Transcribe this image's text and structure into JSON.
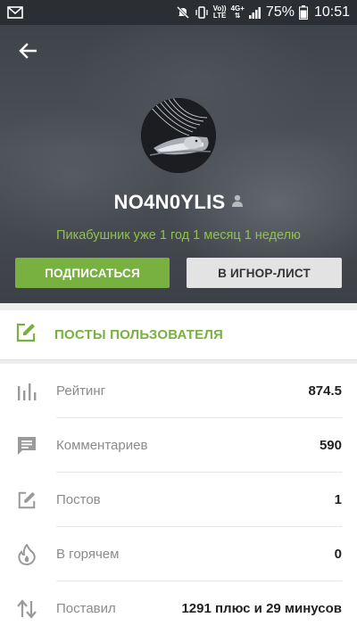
{
  "status_bar": {
    "battery": "75%",
    "time": "10:51",
    "volte_top": "Vo))",
    "volte_bottom": "LTE",
    "net_top": "4G+"
  },
  "header": {
    "username": "NO4N0YLIS",
    "tenure": "Пикабушник уже 1 год 1 месяц 1 неделю",
    "subscribe_label": "ПОДПИСАТЬСЯ",
    "ignore_label": "В ИГНОР-ЛИСТ"
  },
  "posts_link": {
    "label": "ПОСТЫ ПОЛЬЗОВАТЕЛЯ",
    "icon": "edit-icon"
  },
  "stats": [
    {
      "label": "Рейтинг",
      "value": "874.5",
      "icon": "bar-chart-icon"
    },
    {
      "label": "Комментариев",
      "value": "590",
      "icon": "comment-icon"
    },
    {
      "label": "Постов",
      "value": "1",
      "icon": "edit-icon"
    },
    {
      "label": "В горячем",
      "value": "0",
      "icon": "fire-icon"
    },
    {
      "label": "Поставил",
      "value": "1291 плюс и 29 минусов",
      "icon": "sort-arrows-icon"
    }
  ],
  "colors": {
    "accent": "#78b13f",
    "status_bar": "#2b2e33",
    "header_bg": "#45494f",
    "ignore_button": "#e3e3e3"
  }
}
